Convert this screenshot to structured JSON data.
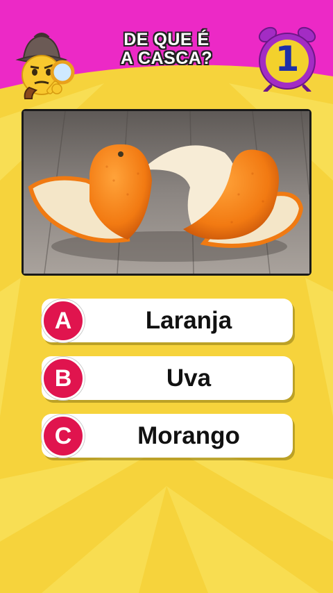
{
  "header": {
    "title_line1": "DE QUE É",
    "title_line2": "A CASCA?",
    "mascot_icon": "detective-emoji-icon",
    "timer_icon": "alarm-clock-icon",
    "counter": "1"
  },
  "image": {
    "subject_icon": "orange-peel-photo"
  },
  "answers": [
    {
      "letter": "A",
      "text": "Laranja"
    },
    {
      "letter": "B",
      "text": "Uva"
    },
    {
      "letter": "C",
      "text": "Morango"
    }
  ],
  "colors": {
    "header_bg": "#ec29c6",
    "background": "#f6d33c",
    "badge": "#e0144e",
    "clock_face": "#f3d12c",
    "clock_ring": "#a32cc4",
    "counter": "#1d2fa8"
  }
}
